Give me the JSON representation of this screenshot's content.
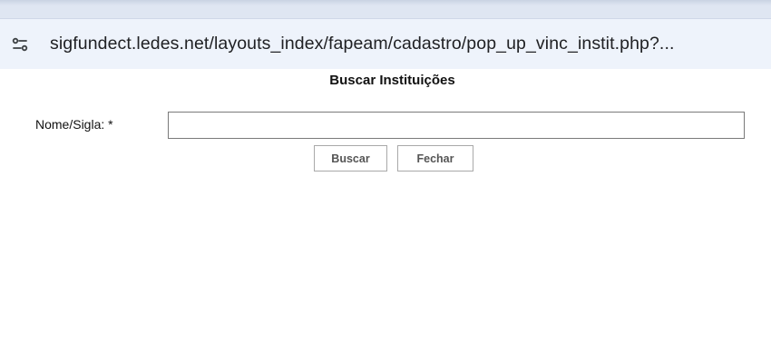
{
  "browser": {
    "url": "sigfundect.ledes.net/layouts_index/fapeam/cadastro/pop_up_vinc_instit.php?...",
    "site_info_icon": "tune-icon"
  },
  "page": {
    "title": "Buscar Instituições"
  },
  "form": {
    "name_label": "Nome/Sigla: *",
    "name_value": "",
    "search_button": "Buscar",
    "close_button": "Fechar"
  }
}
